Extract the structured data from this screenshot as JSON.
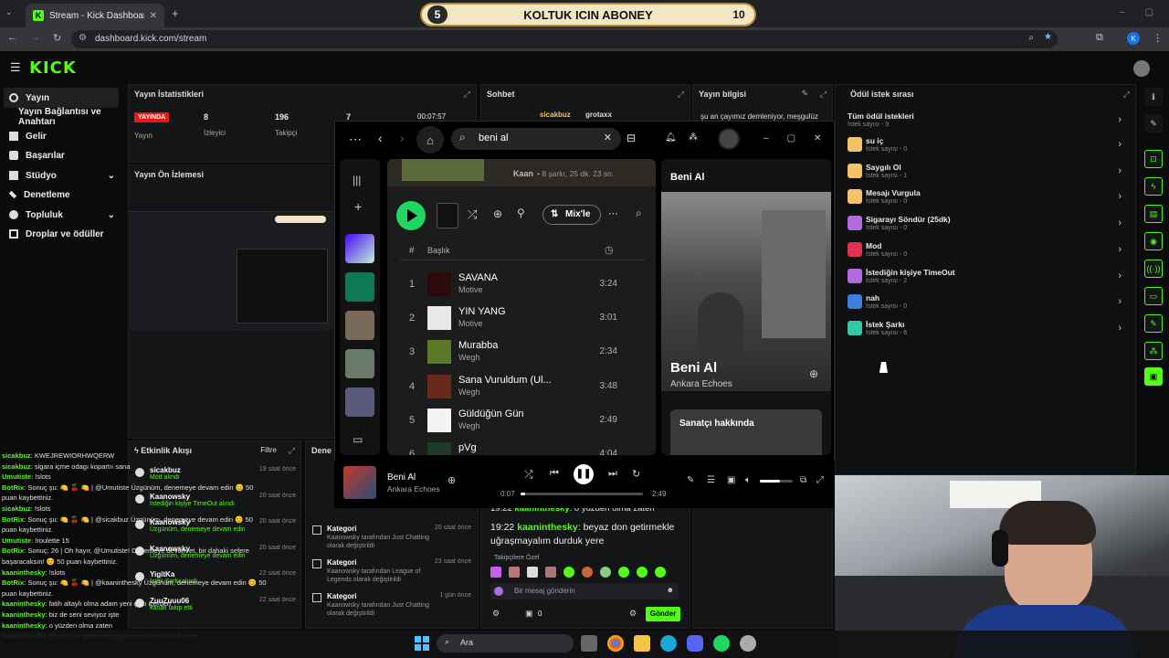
{
  "browser": {
    "tab_title": "Stream - Kick Dashboard",
    "url": "dashboard.kick.com/stream",
    "profile_initial": "K"
  },
  "overlay_goal": {
    "left_num": "5",
    "text": "KOLTUK ICIN ABONEY",
    "right_num": "10"
  },
  "kick": {
    "logo": "KICK"
  },
  "sidebar": {
    "items": [
      {
        "label": "Yayın",
        "icon": "broadcast-icon",
        "active": true
      },
      {
        "label": "Yayın Bağlantısı ve Anahtarı",
        "icon": "",
        "active": false
      },
      {
        "label": "Gelir",
        "icon": "dollar-icon",
        "active": false
      },
      {
        "label": "Başarılar",
        "icon": "trophy-icon",
        "active": false
      },
      {
        "label": "Stüdyo",
        "icon": "studio-icon",
        "active": false
      },
      {
        "label": "Denetleme",
        "icon": "hammer-icon",
        "active": false
      },
      {
        "label": "Topluluk",
        "icon": "users-icon",
        "active": false
      },
      {
        "label": "Droplar ve ödüller",
        "icon": "gift-icon",
        "active": false
      }
    ]
  },
  "stats": {
    "title": "Yayın İstatistikleri",
    "live_badge": "YAYINDA",
    "live_label": "Yayın",
    "viewers": "8",
    "viewers_label": "İzleyici",
    "followers": "196",
    "followers_label": "Takipçi",
    "subs": "7",
    "duration": "00:07:57"
  },
  "preview": {
    "title": "Yayın Ön İzlemesi"
  },
  "chat_panel": {
    "title": "Sohbet",
    "top_user": "sicakbuz",
    "top_user2": "grotaxx",
    "line1_time": "19:22",
    "line1_user": "kaaninthesky",
    "line1_text": "o yüzden olma zaten",
    "line2_time": "19:22",
    "line2_user": "kaaninthesky",
    "line2_text": "beyaz don getirmekle uğraşmayalım durduk yere",
    "followers_only": "Takipçilere Özel",
    "input_placeholder": "Bir mesaj gönderin",
    "count": "0",
    "send_label": "Gönder"
  },
  "stream_info": {
    "title": "Yayın bilgisi",
    "text": "şu an çayımız demleniyor, meşgulüz"
  },
  "rewards": {
    "title": "Ödül istek sırası",
    "all_label": "Tüm ödül istekleri",
    "all_count": "İstek sayısı - 9",
    "items": [
      {
        "name": "su iç",
        "count": "İstek sayısı - 0",
        "color": "#f5c26b"
      },
      {
        "name": "Saygılı Ol",
        "count": "İstek sayısı - 1",
        "color": "#f5c26b"
      },
      {
        "name": "Mesajı Vurgula",
        "count": "İstek sayısı - 0",
        "color": "#f5c26b"
      },
      {
        "name": "Sigarayı Söndür (25dk)",
        "count": "İstek sayısı - 0",
        "color": "#b06bdc"
      },
      {
        "name": "Mod",
        "count": "İstek sayısı - 0",
        "color": "#e0334f"
      },
      {
        "name": "İstediğin kişiye TimeOut",
        "count": "İstek sayısı - 2",
        "color": "#b06bdc"
      },
      {
        "name": "nah",
        "count": "İstek sayısı - 0",
        "color": "#3d7fe0"
      },
      {
        "name": "İstek Şarkı",
        "count": "İstek sayısı - 6",
        "color": "#35c7a5"
      }
    ]
  },
  "spotify": {
    "search_value": "beni al",
    "album_artist": "Kaan",
    "album_meta": "• 8 şarkı, 25 dk. 23 sn.",
    "mix_label": "Mix'le",
    "col_num": "#",
    "col_title": "Başlık",
    "tracks": [
      {
        "n": "1",
        "title": "SAVANA",
        "artist": "Motive",
        "dur": "3:24",
        "art": "#2a0a0a"
      },
      {
        "n": "2",
        "title": "YIN YANG",
        "artist": "Motive",
        "dur": "3:01",
        "art": "#e8e8e8"
      },
      {
        "n": "3",
        "title": "Murabba",
        "artist": "Wegh",
        "dur": "2:34",
        "art": "#5a7a2a"
      },
      {
        "n": "4",
        "title": "Sana Vuruldum (Ul...",
        "artist": "Wegh",
        "dur": "3:48",
        "art": "#6a2a1a"
      },
      {
        "n": "5",
        "title": "Güldüğün Gün",
        "artist": "Wegh",
        "dur": "2:49",
        "art": "#f4f4f4"
      },
      {
        "n": "6",
        "title": "pVg",
        "artist": "",
        "dur": "4:04",
        "art": "#1f3a2a"
      }
    ],
    "np_header": "Beni Al",
    "np_title": "Beni Al",
    "np_artist": "Ankara Echoes",
    "about_artist": "Sanatçı hakkında",
    "player_title": "Beni Al",
    "player_artist": "Ankara Echoes",
    "time_current": "0:07",
    "time_total": "2:49",
    "progress": 0.04,
    "volume": 0.6
  },
  "activity": {
    "title": "Etkinlik Akışı",
    "filter_label": "Filtre",
    "items": [
      {
        "name": "sicakbuz",
        "desc": "Mod alındı",
        "time": "19 saat önce"
      },
      {
        "name": "Kaanowsky",
        "desc": "İstediğin kişiye TimeOut alındı",
        "time": "20 saat önce"
      },
      {
        "name": "Kaanowsky",
        "desc": "Üzgünüm, denemeye devam edin",
        "time": "20 saat önce"
      },
      {
        "name": "Kaanowsky",
        "desc": "Üzgünüm, denemeye devam edin",
        "time": "20 saat önce"
      },
      {
        "name": "YigitKa",
        "desc": "İstek Şarkı alındı",
        "time": "22 saat önce"
      },
      {
        "name": "ZuuZuuu06",
        "desc": "kanalı takip etti",
        "time": "22 saat önce"
      }
    ]
  },
  "moderation": {
    "title": "Dene",
    "items": [
      {
        "kind": "Kategori",
        "desc": "Kaanowsky tarafından Just Chatting olarak değiştirildi",
        "time": "20 saat önce"
      },
      {
        "kind": "Kategori",
        "desc": "Kaanowsky tarafından League of Legends olarak değiştirildi",
        "time": "23 saat önce"
      },
      {
        "kind": "Kategori",
        "desc": "Kaanowsky tarafından Just Chatting olarak değiştirildi",
        "time": "1 gün önce"
      }
    ]
  },
  "left_chat": [
    {
      "user": "sicakbuz",
      "text": ": KWEJREWIORHWQERW"
    },
    {
      "user": "sicakbuz",
      "text": ": sigara içme odagı kopartıı sana"
    },
    {
      "user": "Umutiste",
      "text": ": !slots"
    },
    {
      "user": "BotRix",
      "text": ": Sonuç şu: 🍋 🍒 🍋 | @Umutiste Üzgünüm, denemeye devam edin 😊 50"
    },
    {
      "user": "",
      "text": "puan kaybettiniz."
    },
    {
      "user": "sicakbuz",
      "text": ": !slots"
    },
    {
      "user": "BotRix",
      "text": ": Sonuç şu: 🍋 🍒 🍋 | @sicakbuz Üzgünüm, denemeye devam edin 😊 50"
    },
    {
      "user": "",
      "text": "puan kaybettiniz."
    },
    {
      "user": "Umutiste",
      "text": ": !roulette 15"
    },
    {
      "user": "BotRix",
      "text": ": Sonuç: 26 | Oh hayır, @Umutiste! Denemeye devam et, bir dahaki sefere"
    },
    {
      "user": "",
      "text": "başaracaksın! 😊 50 puan kaybettiniz."
    },
    {
      "user": "kaaninthesky",
      "text": ": !slots"
    },
    {
      "user": "BotRix",
      "text": ": Sonuç şu: 🍋 🍒 🍋 | @kaaninthesky Üzgünüm, denemeye devam edin 😊 50"
    },
    {
      "user": "",
      "text": "puan kaybettiniz."
    },
    {
      "user": "kaaninthesky",
      "text": ": fatih altaylı olma adam yeni çıktı içerden"
    },
    {
      "user": "kaaninthesky",
      "text": ": biz de seni seviyoz işte"
    },
    {
      "user": "kaaninthesky",
      "text": ": o yüzden olma zaten"
    },
    {
      "user": "kaaninthesky",
      "text": ": beyaz don getirmekle uğraşmayalım durduk yere"
    }
  ],
  "taskbar": {
    "search_label": "Ara"
  },
  "colors": {
    "kick_green": "#53fc18",
    "spotify_green": "#1ed760",
    "panel_bg": "#141517"
  }
}
